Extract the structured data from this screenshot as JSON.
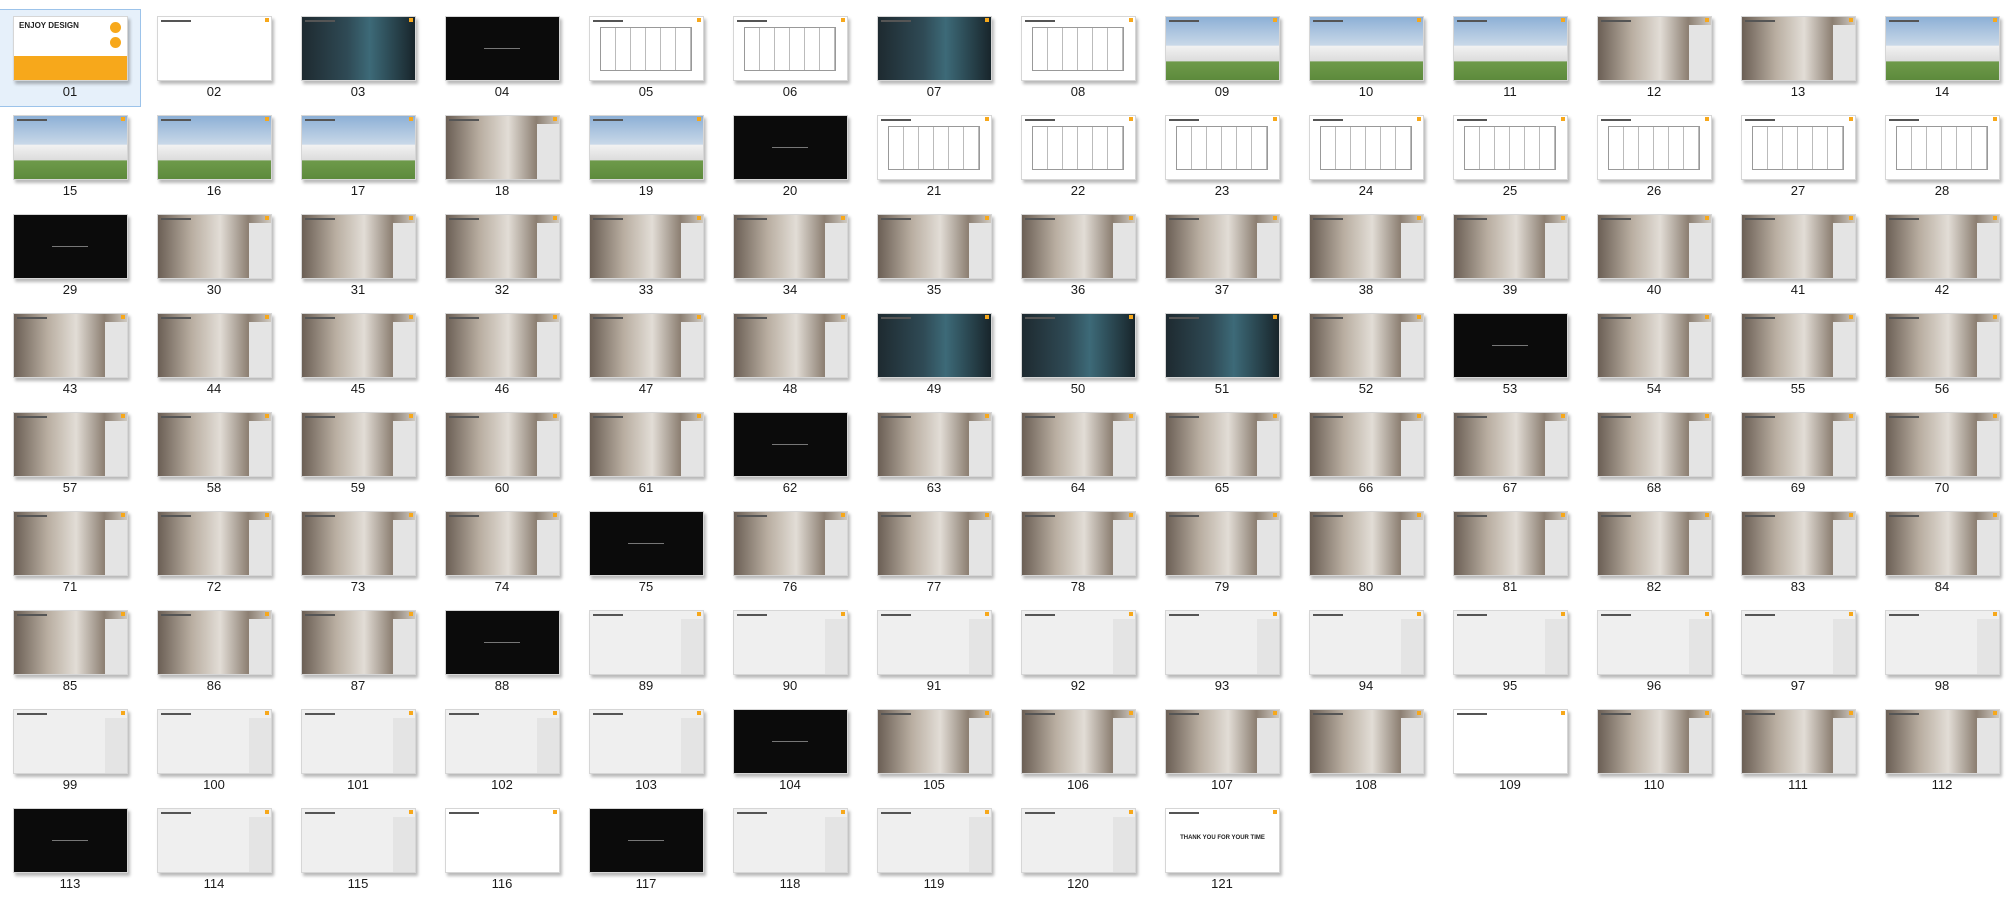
{
  "window": {
    "title": ""
  },
  "selected": "01",
  "cover": {
    "title": "ENJOY DESIGN"
  },
  "thanks_text": "THANK YOU FOR YOUR TIME",
  "slides": [
    {
      "n": "01",
      "t": "cover"
    },
    {
      "n": "02",
      "t": "white"
    },
    {
      "n": "03",
      "t": "dark"
    },
    {
      "n": "04",
      "t": "black"
    },
    {
      "n": "05",
      "t": "plan"
    },
    {
      "n": "06",
      "t": "plan"
    },
    {
      "n": "07",
      "t": "dark"
    },
    {
      "n": "08",
      "t": "plan"
    },
    {
      "n": "09",
      "t": "render"
    },
    {
      "n": "10",
      "t": "render"
    },
    {
      "n": "11",
      "t": "render"
    },
    {
      "n": "12",
      "t": "interior"
    },
    {
      "n": "13",
      "t": "interior"
    },
    {
      "n": "14",
      "t": "render"
    },
    {
      "n": "15",
      "t": "render"
    },
    {
      "n": "16",
      "t": "render"
    },
    {
      "n": "17",
      "t": "render"
    },
    {
      "n": "18",
      "t": "interior"
    },
    {
      "n": "19",
      "t": "render"
    },
    {
      "n": "20",
      "t": "black"
    },
    {
      "n": "21",
      "t": "plan"
    },
    {
      "n": "22",
      "t": "plan"
    },
    {
      "n": "23",
      "t": "plan"
    },
    {
      "n": "24",
      "t": "plan"
    },
    {
      "n": "25",
      "t": "plan"
    },
    {
      "n": "26",
      "t": "plan"
    },
    {
      "n": "27",
      "t": "plan"
    },
    {
      "n": "28",
      "t": "plan"
    },
    {
      "n": "29",
      "t": "black"
    },
    {
      "n": "30",
      "t": "interior"
    },
    {
      "n": "31",
      "t": "interior"
    },
    {
      "n": "32",
      "t": "interior"
    },
    {
      "n": "33",
      "t": "interior"
    },
    {
      "n": "34",
      "t": "interior"
    },
    {
      "n": "35",
      "t": "interior"
    },
    {
      "n": "36",
      "t": "interior"
    },
    {
      "n": "37",
      "t": "interior"
    },
    {
      "n": "38",
      "t": "interior"
    },
    {
      "n": "39",
      "t": "interior"
    },
    {
      "n": "40",
      "t": "interior"
    },
    {
      "n": "41",
      "t": "interior"
    },
    {
      "n": "42",
      "t": "interior"
    },
    {
      "n": "43",
      "t": "interior"
    },
    {
      "n": "44",
      "t": "interior"
    },
    {
      "n": "45",
      "t": "interior"
    },
    {
      "n": "46",
      "t": "interior"
    },
    {
      "n": "47",
      "t": "interior"
    },
    {
      "n": "48",
      "t": "interior"
    },
    {
      "n": "49",
      "t": "dark"
    },
    {
      "n": "50",
      "t": "dark"
    },
    {
      "n": "51",
      "t": "dark"
    },
    {
      "n": "52",
      "t": "interior"
    },
    {
      "n": "53",
      "t": "black"
    },
    {
      "n": "54",
      "t": "interior"
    },
    {
      "n": "55",
      "t": "interior"
    },
    {
      "n": "56",
      "t": "interior"
    },
    {
      "n": "57",
      "t": "interior"
    },
    {
      "n": "58",
      "t": "interior"
    },
    {
      "n": "59",
      "t": "interior"
    },
    {
      "n": "60",
      "t": "interior"
    },
    {
      "n": "61",
      "t": "interior"
    },
    {
      "n": "62",
      "t": "black"
    },
    {
      "n": "63",
      "t": "interior"
    },
    {
      "n": "64",
      "t": "interior"
    },
    {
      "n": "65",
      "t": "interior"
    },
    {
      "n": "66",
      "t": "interior"
    },
    {
      "n": "67",
      "t": "interior"
    },
    {
      "n": "68",
      "t": "interior"
    },
    {
      "n": "69",
      "t": "interior"
    },
    {
      "n": "70",
      "t": "interior"
    },
    {
      "n": "71",
      "t": "interior"
    },
    {
      "n": "72",
      "t": "interior"
    },
    {
      "n": "73",
      "t": "interior"
    },
    {
      "n": "74",
      "t": "interior"
    },
    {
      "n": "75",
      "t": "black"
    },
    {
      "n": "76",
      "t": "interior"
    },
    {
      "n": "77",
      "t": "interior"
    },
    {
      "n": "78",
      "t": "interior"
    },
    {
      "n": "79",
      "t": "interior"
    },
    {
      "n": "80",
      "t": "interior"
    },
    {
      "n": "81",
      "t": "interior"
    },
    {
      "n": "82",
      "t": "interior"
    },
    {
      "n": "83",
      "t": "interior"
    },
    {
      "n": "84",
      "t": "interior"
    },
    {
      "n": "85",
      "t": "interior"
    },
    {
      "n": "86",
      "t": "interior"
    },
    {
      "n": "87",
      "t": "interior"
    },
    {
      "n": "88",
      "t": "black"
    },
    {
      "n": "89",
      "t": "text"
    },
    {
      "n": "90",
      "t": "text"
    },
    {
      "n": "91",
      "t": "text"
    },
    {
      "n": "92",
      "t": "text"
    },
    {
      "n": "93",
      "t": "text"
    },
    {
      "n": "94",
      "t": "text"
    },
    {
      "n": "95",
      "t": "text"
    },
    {
      "n": "96",
      "t": "text"
    },
    {
      "n": "97",
      "t": "text"
    },
    {
      "n": "98",
      "t": "text"
    },
    {
      "n": "99",
      "t": "text"
    },
    {
      "n": "100",
      "t": "text"
    },
    {
      "n": "101",
      "t": "text"
    },
    {
      "n": "102",
      "t": "text"
    },
    {
      "n": "103",
      "t": "text"
    },
    {
      "n": "104",
      "t": "black"
    },
    {
      "n": "105",
      "t": "interior"
    },
    {
      "n": "106",
      "t": "interior"
    },
    {
      "n": "107",
      "t": "interior"
    },
    {
      "n": "108",
      "t": "interior"
    },
    {
      "n": "109",
      "t": "white"
    },
    {
      "n": "110",
      "t": "interior"
    },
    {
      "n": "111",
      "t": "interior"
    },
    {
      "n": "112",
      "t": "interior"
    },
    {
      "n": "113",
      "t": "black"
    },
    {
      "n": "114",
      "t": "text"
    },
    {
      "n": "115",
      "t": "text"
    },
    {
      "n": "116",
      "t": "white"
    },
    {
      "n": "117",
      "t": "black"
    },
    {
      "n": "118",
      "t": "text"
    },
    {
      "n": "119",
      "t": "text"
    },
    {
      "n": "120",
      "t": "text"
    },
    {
      "n": "121",
      "t": "thanks"
    }
  ]
}
